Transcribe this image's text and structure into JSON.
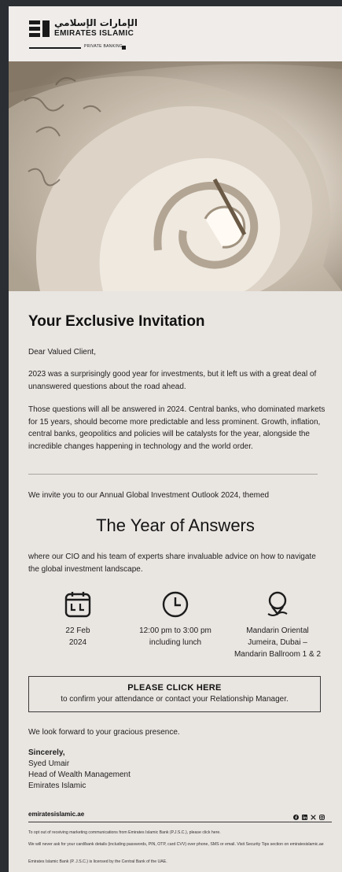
{
  "header": {
    "brand_ar": "الإمارات الإسلامي",
    "brand_en": "EMIRATES ISLAMIC",
    "private_banking": "PRIVATE BANKING"
  },
  "hero": {
    "icon": "spiral-staircase-image"
  },
  "invitation": {
    "title": "Your Exclusive Invitation",
    "greeting": "Dear Valued Client,",
    "para1": "2023 was a surprisingly good year for investments, but it left us with a great deal of unanswered questions about the road ahead.",
    "para2": "Those questions will all be answered in 2024. Central banks, who dominated markets for 15 years, should become more predictable and less prominent. Growth, inflation, central banks, geopolitics and policies will be catalysts for the year, alongside the incredible changes happening in technology and the world order.",
    "invite_line": "We invite you to our Annual Global Investment Outlook 2024, themed",
    "theme": "The Year of Answers",
    "theme_desc": "where our CIO and his team of experts share invaluable advice on how to navigate the global investment landscape."
  },
  "details": {
    "date_icon": "calendar-icon",
    "date_line1": "22 Feb",
    "date_line2": "2024",
    "time_icon": "clock-icon",
    "time_line1": "12:00 pm to 3:00 pm",
    "time_line2": "including lunch",
    "location_icon": "location-pin-icon",
    "location_line1": "Mandarin Oriental",
    "location_line2": "Jumeira, Dubai –",
    "location_line3": "Mandarin Ballroom 1 & 2"
  },
  "cta": {
    "heading": "PLEASE CLICK HERE",
    "subtext": "to confirm your attendance or contact your Relationship Manager."
  },
  "closing": {
    "line": "We look forward to your gracious presence.",
    "sincerely": "Sincerely,",
    "name": "Syed Umair",
    "role": "Head of Wealth Management",
    "company": "Emirates Islamic"
  },
  "footer": {
    "website": "emiratesislamic.ae",
    "social_icons": [
      "facebook-icon",
      "linkedin-icon",
      "x-icon",
      "instagram-icon"
    ],
    "optout": "To opt out of receiving marketing communications from Emirates Islamic Bank (P.J.S.C.), please click here.",
    "security": "We will never ask for your card/bank details (including passwords, PIN, OTP, card CVV) over phone, SMS or email. Visit Security Tips section on emiratesislamic.ae",
    "license": "Emirates Islamic Bank (P. J.S.C.) is licensed by the Central Bank of the UAE."
  },
  "colors": {
    "background": "#e9e5e1",
    "frame": "#2b2e33",
    "text": "#1f1f1f"
  }
}
